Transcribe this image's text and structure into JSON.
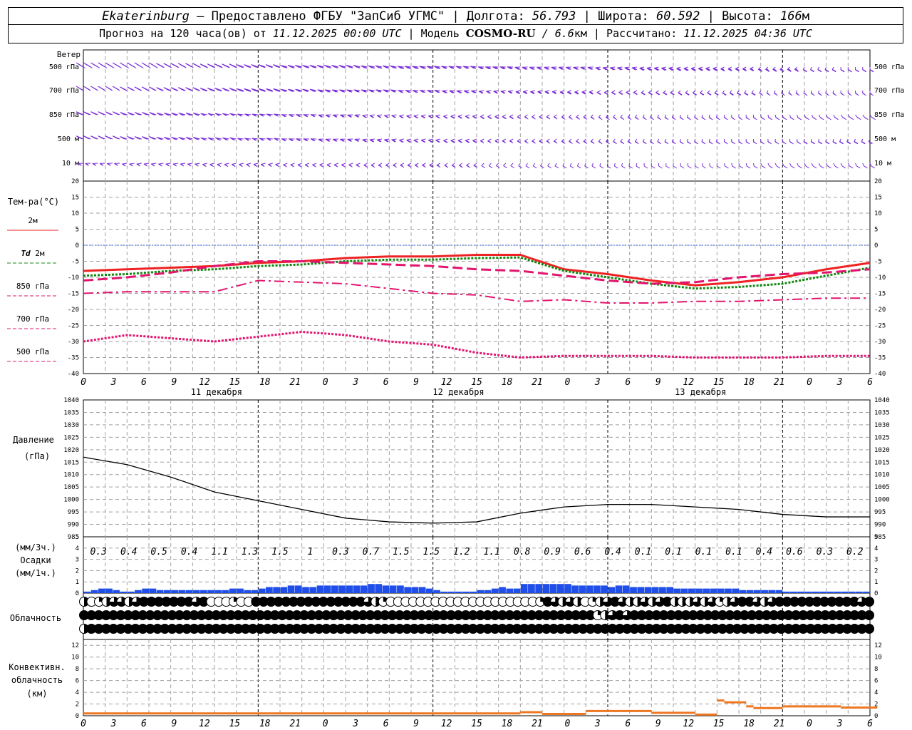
{
  "header": {
    "station": "Ekaterinburg",
    "provider": " – Предоставлено ФГБУ \"ЗапСиб УГМС\" | Долгота: ",
    "longitude": "56.793",
    "lat_label": " | Широта: ",
    "latitude": "60.592",
    "alt_label": " | Высота: ",
    "altitude": "166",
    "alt_unit": "м",
    "forecast_label": "Прогноз на 120 часа(ов) от ",
    "run_time": "11.12.2025 00:00 UTC",
    "model_label": "  | Модель ",
    "model_name": "COSMO-RU",
    "model_res": " / 6.6",
    "model_res_unit": "км",
    "calc_label": " | Рассчитано: ",
    "calc_time": "11.12.2025 04:36 UTC"
  },
  "colors": {
    "wind": "#7b2fd6",
    "t2m": "#ee2222",
    "td2m": "#118811",
    "t850": "#e2156e",
    "t700": "#e2156e",
    "t500": "#e2156e",
    "pressure": "#000000",
    "precip": "#1f4ee8",
    "conv": "#ee7722",
    "zero_line": "#3355dd",
    "grid": "#a0a0a0"
  },
  "wind_panel": {
    "title": "Ветер",
    "levels": [
      "500 гПа",
      "700 гПа",
      "850 гПа",
      "500 м",
      "10  м"
    ]
  },
  "temp_panel": {
    "title": "Тем-ра(°C)",
    "legend": [
      {
        "key": "2m",
        "label": "2м"
      },
      {
        "key": "td",
        "label_italic": "Td",
        "label": " 2м"
      },
      {
        "key": "850",
        "label": "850 гПа"
      },
      {
        "key": "700",
        "label": "700 гПа"
      },
      {
        "key": "500",
        "label": "500 гПа"
      }
    ]
  },
  "pressure_panel": {
    "title1": "Давление",
    "title2": "(гПа)"
  },
  "precip_panel": {
    "title1": "(мм/3ч.)",
    "title2": "Осадки",
    "title3": "(мм/1ч.)"
  },
  "cloud_panel": {
    "title": "Облачность"
  },
  "conv_panel": {
    "title1": "Конвективн.",
    "title2": "облачность",
    "title3": "(км)"
  },
  "x_hour_labels": [
    "0",
    "3",
    "6",
    "9",
    "12",
    "15",
    "18",
    "21",
    "0",
    "3",
    "6",
    "9",
    "12",
    "15",
    "18",
    "21",
    "0",
    "3",
    "6",
    "9",
    "12",
    "15",
    "18",
    "21",
    "0",
    "3",
    "6"
  ],
  "day_labels": [
    "11 декабря",
    "12 декабря",
    "13 декабря"
  ],
  "chart_data": [
    {
      "type": "line",
      "name": "temperature",
      "hours": [
        0,
        6,
        12,
        18,
        24,
        30,
        36,
        42,
        48,
        54,
        60,
        66,
        72,
        78,
        84,
        90,
        96,
        102,
        108
      ],
      "ylim": [
        -40,
        20
      ],
      "ytick_step": 5,
      "series": [
        {
          "name": "2м",
          "values": [
            -8,
            -7.5,
            -7,
            -6.5,
            -5.5,
            -5,
            -4,
            -3.5,
            -3.5,
            -3,
            -3,
            -7.5,
            -9,
            -11,
            -12.5,
            -11.5,
            -10,
            -7.5,
            -5.5
          ]
        },
        {
          "name": "Td 2м",
          "values": [
            -9.5,
            -9,
            -8,
            -7.5,
            -6.5,
            -6,
            -5,
            -4.5,
            -4.5,
            -4,
            -3.8,
            -8,
            -10,
            -12,
            -13.5,
            -13,
            -12,
            -9.5,
            -7
          ]
        },
        {
          "name": "850 гПа",
          "values": [
            -11,
            -10,
            -8.5,
            -6.5,
            -5,
            -5,
            -5.5,
            -6,
            -6.5,
            -7.5,
            -8,
            -9.5,
            -11,
            -12,
            -11.5,
            -10,
            -9,
            -8.5,
            -7.5
          ]
        },
        {
          "name": "700 гПа",
          "values": [
            -15,
            -14.5,
            -14.5,
            -14.5,
            -11,
            -11.5,
            -12,
            -13.5,
            -15,
            -15.5,
            -17.5,
            -17,
            -18,
            -18,
            -17.5,
            -17.5,
            -17,
            -16.5,
            -16.5
          ]
        },
        {
          "name": "500 гПа",
          "values": [
            -30,
            -28,
            -29,
            -30,
            -28.5,
            -27,
            -28,
            -30,
            -31,
            -33.5,
            -35,
            -34.5,
            -34.5,
            -34.5,
            -35,
            -35,
            -35,
            -34.5,
            -34.5
          ]
        }
      ]
    },
    {
      "type": "line",
      "name": "pressure",
      "hours": [
        0,
        6,
        12,
        18,
        24,
        30,
        36,
        42,
        48,
        54,
        60,
        66,
        72,
        78,
        84,
        90,
        96,
        102,
        108
      ],
      "ylim": [
        985,
        1040
      ],
      "ytick_step": 5,
      "series": [
        {
          "name": "Давление",
          "values": [
            1017,
            1014,
            1009,
            1003,
            999.5,
            996,
            992.5,
            991,
            990.5,
            991,
            994.5,
            997,
            998,
            998,
            997,
            996,
            994,
            993,
            993
          ]
        }
      ]
    },
    {
      "type": "bar",
      "name": "precipitation",
      "ylim": [
        0,
        5
      ],
      "ytick_step": 1,
      "totals_3h": [
        "0.3",
        "0.4",
        "0.5",
        "0.4",
        "1.1",
        "1.3",
        "1.5",
        "1",
        "0.3",
        "0.7",
        "1.5",
        "1.5",
        "1.2",
        "1.1",
        "0.8",
        "0.9",
        "0.6",
        "0.4",
        "0.1",
        "0.1",
        "0.1",
        "0.1",
        "0.4",
        "0.6",
        "0.3",
        "0.2"
      ],
      "hourly": [
        0.1,
        0.2,
        0.3,
        0.3,
        0.2,
        0.1,
        0.1,
        0.2,
        0.3,
        0.3,
        0.2,
        0.2,
        0.2,
        0.2,
        0.2,
        0.2,
        0.2,
        0.2,
        0.2,
        0.2,
        0.3,
        0.3,
        0.2,
        0.2,
        0.3,
        0.4,
        0.4,
        0.4,
        0.5,
        0.5,
        0.4,
        0.4,
        0.5,
        0.5,
        0.5,
        0.5,
        0.5,
        0.5,
        0.5,
        0.6,
        0.6,
        0.5,
        0.5,
        0.5,
        0.4,
        0.4,
        0.4,
        0.3,
        0.2,
        0.1,
        0.1,
        0.1,
        0.1,
        0.1,
        0.2,
        0.2,
        0.3,
        0.4,
        0.3,
        0.3,
        0.6,
        0.6,
        0.6,
        0.6,
        0.6,
        0.6,
        0.6,
        0.5,
        0.5,
        0.5,
        0.5,
        0.5,
        0.4,
        0.5,
        0.5,
        0.4,
        0.4,
        0.4,
        0.4,
        0.4,
        0.4,
        0.3,
        0.3,
        0.3,
        0.3,
        0.3,
        0.3,
        0.3,
        0.3,
        0.3,
        0.2,
        0.2,
        0.2,
        0.2,
        0.2,
        0.2,
        0.1,
        0.1,
        0.1,
        0.1,
        0.1,
        0.1,
        0.1,
        0.1,
        0.1,
        0.1,
        0.1,
        0.1,
        0.1,
        0.1,
        0.1,
        0.1,
        0.1,
        0.1,
        0.1,
        0.1,
        0.1,
        0.1,
        0.1,
        0.1,
        0.1,
        0.1,
        0.1,
        0.1,
        0.1,
        0.1,
        0.1,
        0.1,
        0.1,
        0.1,
        0.1,
        0.1,
        0.1,
        0.1,
        0.2,
        0.2,
        0.2,
        0.2,
        0.2,
        0.2,
        0.2,
        0.2,
        0.3,
        0.3,
        0.3,
        0.3,
        0.3,
        0.3,
        0.2,
        0.2,
        0.2,
        0.2,
        0.2,
        0.1,
        0.1,
        0.1,
        0.1,
        0.1,
        0.1,
        0.2
      ]
    },
    {
      "type": "line",
      "name": "convective_cloud",
      "ylim": [
        0,
        13
      ],
      "yticks": [
        0,
        2,
        4,
        6,
        8,
        10,
        12
      ],
      "segments": [
        {
          "from": 0,
          "to": 60,
          "value": 0.4
        },
        {
          "from": 60,
          "to": 63,
          "value": 0.6
        },
        {
          "from": 63,
          "to": 69,
          "value": 0.3
        },
        {
          "from": 69,
          "to": 78,
          "value": 0.8
        },
        {
          "from": 78,
          "to": 84,
          "value": 0.5
        },
        {
          "from": 84,
          "to": 87,
          "value": 0.2
        },
        {
          "from": 87,
          "to": 88,
          "value": 2.6
        },
        {
          "from": 88,
          "to": 91,
          "value": 2.3
        },
        {
          "from": 91,
          "to": 92,
          "value": 1.6
        },
        {
          "from": 92,
          "to": 96,
          "value": 1.3
        },
        {
          "from": 96,
          "to": 104,
          "value": 1.6
        },
        {
          "from": 104,
          "to": 109,
          "value": 1.4
        }
      ]
    },
    {
      "type": "table",
      "name": "cloud_cover",
      "rows": [
        [
          0.5,
          0,
          0.25,
          0.5,
          0.75,
          0.75,
          0.5,
          0.75,
          1,
          1,
          1,
          1,
          1,
          1,
          1,
          0.75,
          1,
          0,
          0,
          0,
          0.25,
          0,
          0,
          1,
          1,
          1,
          1,
          1,
          1,
          1,
          1,
          1,
          1,
          1,
          1,
          1,
          1,
          1,
          0.75,
          0.5,
          0.25,
          0,
          0,
          0,
          0,
          0,
          0,
          0,
          0,
          0,
          0,
          0,
          0,
          0,
          0,
          0,
          0,
          0,
          0,
          0,
          0,
          0.25,
          1,
          0.75,
          0.5,
          0.75,
          0.5,
          0,
          0.25,
          0.5,
          0.75,
          1,
          0.75,
          0.5,
          0.5,
          0.75,
          0.5,
          0.75,
          1,
          0.5,
          0.5,
          0.5,
          0.75,
          0.5,
          0.75,
          0.25,
          0.5,
          0.75,
          1,
          1,
          0.75,
          0.5,
          0.75,
          1,
          1,
          1,
          1,
          1,
          1,
          1,
          1,
          1,
          1,
          1,
          0.75,
          1
        ],
        [
          1,
          1,
          1,
          1,
          1,
          1,
          1,
          1,
          1,
          1,
          1,
          1,
          1,
          1,
          1,
          1,
          1,
          1,
          1,
          1,
          1,
          1,
          1,
          1,
          1,
          1,
          1,
          1,
          1,
          1,
          1,
          1,
          1,
          1,
          1,
          1,
          1,
          1,
          1,
          1,
          1,
          1,
          1,
          1,
          1,
          1,
          1,
          1,
          1,
          1,
          1,
          1,
          1,
          1,
          1,
          1,
          1,
          1,
          1,
          1,
          1,
          1,
          1,
          1,
          1,
          1,
          1,
          1,
          1,
          1,
          0.25,
          0.5,
          0.75,
          1,
          0.75,
          1,
          1,
          1,
          1,
          1,
          1,
          1,
          1,
          1,
          1,
          1,
          1,
          1,
          1,
          1,
          1,
          1,
          1,
          1,
          1,
          1,
          1,
          1,
          1,
          1,
          1,
          1,
          1,
          1,
          1,
          1,
          1,
          1
        ],
        [
          0.5,
          1,
          1,
          1,
          1,
          1,
          1,
          1,
          1,
          1,
          1,
          1,
          1,
          1,
          1,
          1,
          1,
          1,
          1,
          1,
          1,
          1,
          1,
          1,
          1,
          1,
          1,
          1,
          1,
          1,
          1,
          1,
          1,
          1,
          1,
          1,
          1,
          1,
          1,
          1,
          1,
          1,
          1,
          1,
          1,
          1,
          1,
          1,
          1,
          1,
          1,
          1,
          1,
          1,
          1,
          1,
          1,
          1,
          1,
          1,
          1,
          1,
          1,
          1,
          1,
          1,
          1,
          1,
          1,
          1,
          1,
          1,
          1,
          1,
          1,
          1,
          1,
          1,
          1,
          1,
          1,
          1,
          1,
          1,
          1,
          1,
          1,
          1,
          1,
          1,
          1,
          1,
          1,
          1,
          1,
          1,
          1,
          1,
          1,
          1,
          1,
          1,
          1,
          1,
          1,
          1,
          1,
          1
        ]
      ]
    },
    {
      "type": "scatter",
      "name": "wind_barbs",
      "note": "speeds in knots per level, hourly",
      "levels": [
        {
          "name": "500 гПа",
          "speeds_kt": [
            60,
            60,
            55,
            50,
            45,
            45,
            45,
            40,
            40,
            35,
            35,
            30,
            30,
            30,
            30,
            30,
            25,
            25,
            20,
            20
          ],
          "dirs_deg": [
            270,
            270,
            265,
            260,
            255,
            250,
            250,
            245,
            240,
            240,
            235,
            230,
            230,
            225,
            220,
            215,
            210,
            200,
            190,
            180
          ]
        },
        {
          "name": "700 гПа",
          "speeds_kt": [
            45,
            45,
            40,
            40,
            40,
            35,
            35,
            35,
            30,
            30,
            25,
            25,
            25,
            20,
            20,
            20,
            20,
            15,
            15,
            15
          ],
          "dirs_deg": [
            270,
            265,
            260,
            255,
            250,
            245,
            240,
            240,
            235,
            230,
            225,
            220,
            215,
            210,
            205,
            200,
            195,
            190,
            185,
            180
          ]
        },
        {
          "name": "850 гПа",
          "speeds_kt": [
            30,
            30,
            30,
            25,
            25,
            25,
            25,
            20,
            20,
            20,
            20,
            15,
            15,
            15,
            15,
            15,
            15,
            15,
            15,
            15
          ],
          "dirs_deg": [
            260,
            255,
            250,
            245,
            240,
            235,
            230,
            225,
            220,
            215,
            210,
            205,
            200,
            195,
            190,
            185,
            180,
            175,
            170,
            165
          ]
        },
        {
          "name": "500 м",
          "speeds_kt": [
            30,
            30,
            30,
            30,
            25,
            25,
            25,
            25,
            20,
            20,
            15,
            15,
            15,
            15,
            15,
            15,
            15,
            15,
            20,
            20
          ],
          "dirs_deg": [
            260,
            255,
            250,
            245,
            240,
            235,
            230,
            225,
            220,
            215,
            210,
            205,
            200,
            195,
            190,
            185,
            180,
            180,
            185,
            190
          ]
        },
        {
          "name": "10  м",
          "speeds_kt": [
            15,
            15,
            15,
            15,
            15,
            15,
            15,
            15,
            15,
            15,
            10,
            10,
            10,
            10,
            10,
            10,
            10,
            10,
            10,
            10
          ],
          "dirs_deg": [
            230,
            225,
            225,
            220,
            220,
            215,
            215,
            210,
            210,
            205,
            200,
            195,
            190,
            185,
            180,
            180,
            175,
            170,
            170,
            170
          ]
        }
      ]
    }
  ]
}
